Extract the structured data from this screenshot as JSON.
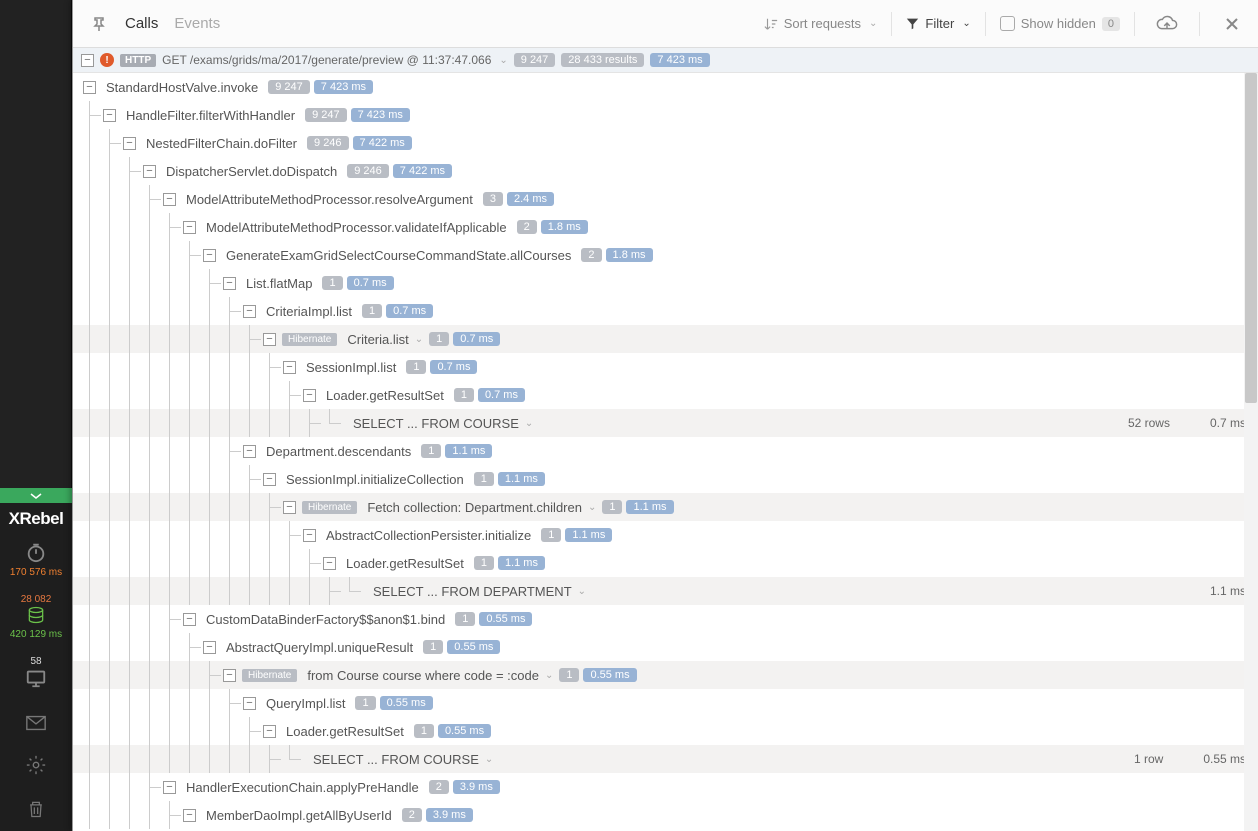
{
  "sidebar": {
    "logo_prefix": "X",
    "logo_text": "Rebel",
    "time_stat": "170 576 ms",
    "db_count": "28 082",
    "db_time": "420 129 ms",
    "session_count": "58"
  },
  "toolbar": {
    "tab_calls": "Calls",
    "tab_events": "Events",
    "sort_label": "Sort requests",
    "filter_label": "Filter",
    "show_hidden": "Show hidden",
    "hidden_count": "0"
  },
  "request": {
    "proto": "HTTP",
    "path": "GET /exams/grids/ma/2017/generate/preview @ 11:37:47.066",
    "count": "9 247",
    "results": "28 433 results",
    "time": "7 423 ms"
  },
  "rows": [
    {
      "d": 0,
      "name": "StandardHostValve.invoke",
      "g": "9 247",
      "b": "7 423 ms"
    },
    {
      "d": 1,
      "name": "HandleFilter.filterWithHandler",
      "g": "9 247",
      "b": "7 423 ms"
    },
    {
      "d": 2,
      "name": "NestedFilterChain.doFilter",
      "g": "9 246",
      "b": "7 422 ms"
    },
    {
      "d": 3,
      "name": "DispatcherServlet.doDispatch",
      "g": "9 246",
      "b": "7 422 ms"
    },
    {
      "d": 4,
      "name": "ModelAttributeMethodProcessor.resolveArgument",
      "g": "3",
      "b": "2.4 ms"
    },
    {
      "d": 5,
      "name": "ModelAttributeMethodProcessor.validateIfApplicable",
      "g": "2",
      "b": "1.8 ms"
    },
    {
      "d": 6,
      "name": "GenerateExamGridSelectCourseCommandState.allCourses",
      "g": "2",
      "b": "1.8 ms"
    },
    {
      "d": 7,
      "name": "List.flatMap",
      "g": "1",
      "b": "0.7 ms"
    },
    {
      "d": 8,
      "name": "CriteriaImpl.list",
      "g": "1",
      "b": "0.7 ms"
    },
    {
      "d": 9,
      "name": "Criteria.list",
      "g": "1",
      "b": "0.7 ms",
      "orm": "Hibernate",
      "hl": true,
      "chev": true
    },
    {
      "d": 10,
      "name": "SessionImpl.list",
      "g": "1",
      "b": "0.7 ms"
    },
    {
      "d": 11,
      "name": "Loader.getResultSet",
      "g": "1",
      "b": "0.7 ms"
    },
    {
      "d": 12,
      "name": "SELECT ... FROM COURSE",
      "hl": true,
      "sql": true,
      "rows": "52 rows",
      "time": "0.7 ms"
    },
    {
      "d": 8,
      "name": "Department.descendants",
      "g": "1",
      "b": "1.1 ms"
    },
    {
      "d": 9,
      "name": "SessionImpl.initializeCollection",
      "g": "1",
      "b": "1.1 ms"
    },
    {
      "d": 10,
      "name": "Fetch collection: Department.children",
      "g": "1",
      "b": "1.1 ms",
      "orm": "Hibernate",
      "hl": true,
      "chev": true
    },
    {
      "d": 11,
      "name": "AbstractCollectionPersister.initialize",
      "g": "1",
      "b": "1.1 ms"
    },
    {
      "d": 12,
      "name": "Loader.getResultSet",
      "g": "1",
      "b": "1.1 ms"
    },
    {
      "d": 13,
      "name": "SELECT ... FROM DEPARTMENT",
      "hl": true,
      "sql": true,
      "time": "1.1 ms"
    },
    {
      "d": 5,
      "name": "CustomDataBinderFactory$$anon$1.bind",
      "g": "1",
      "b": "0.55 ms"
    },
    {
      "d": 6,
      "name": "AbstractQueryImpl.uniqueResult",
      "g": "1",
      "b": "0.55 ms"
    },
    {
      "d": 7,
      "name": "from Course course where code = :code",
      "g": "1",
      "b": "0.55 ms",
      "orm": "Hibernate",
      "hl": true,
      "chev": true
    },
    {
      "d": 8,
      "name": "QueryImpl.list",
      "g": "1",
      "b": "0.55 ms"
    },
    {
      "d": 9,
      "name": "Loader.getResultSet",
      "g": "1",
      "b": "0.55 ms"
    },
    {
      "d": 10,
      "name": "SELECT ... FROM COURSE",
      "hl": true,
      "sql": true,
      "rows": "1 row",
      "time": "0.55 ms"
    },
    {
      "d": 4,
      "name": "HandlerExecutionChain.applyPreHandle",
      "g": "2",
      "b": "3.9 ms"
    },
    {
      "d": 5,
      "name": "MemberDaoImpl.getAllByUserId",
      "g": "2",
      "b": "3.9 ms"
    }
  ]
}
